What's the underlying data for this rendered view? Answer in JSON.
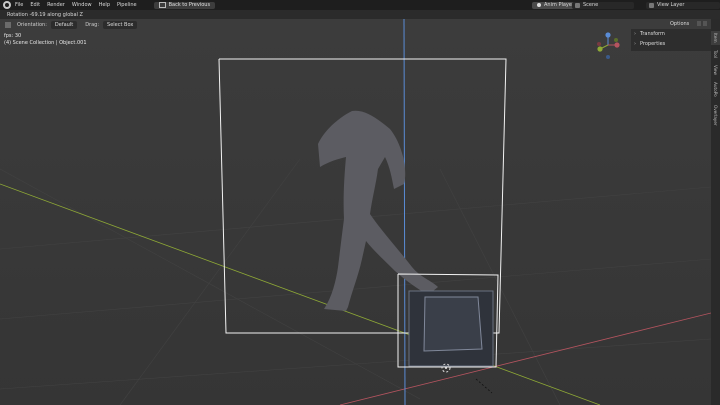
{
  "menu": {
    "items": [
      "File",
      "Edit",
      "Render",
      "Window",
      "Help",
      "Pipeline"
    ],
    "back_to_previous": "Back to Previous"
  },
  "topright": {
    "anim_player": "Anim Player",
    "scene": "Scene",
    "view_layer": "View Layer"
  },
  "status": {
    "operation": "Rotation -69.19 along global Z"
  },
  "header": {
    "orientation_label": "Orientation:",
    "orientation_value": "Default",
    "drag_label": "Drag:",
    "drag_value": "Select Box",
    "options": "Options"
  },
  "overlay": {
    "fps": "fps: 30",
    "collection": "(4) Scene Collection | Object.001"
  },
  "npanel": {
    "rows": [
      "Transform",
      "Properties"
    ]
  },
  "sidebar_tabs": [
    "Item",
    "Tool",
    "View",
    "AutoPo",
    "Overlayer"
  ],
  "colors": {
    "viewport_bg": "#3a3a3a",
    "x_axis": "#b5545f",
    "y_axis": "#8ea836",
    "z_axis": "#5a8cd6",
    "selection": "#f2f2f2"
  },
  "icons": {
    "app_logo": "blender-logo-icon",
    "gizmo": "navigation-gizmo-icon"
  }
}
